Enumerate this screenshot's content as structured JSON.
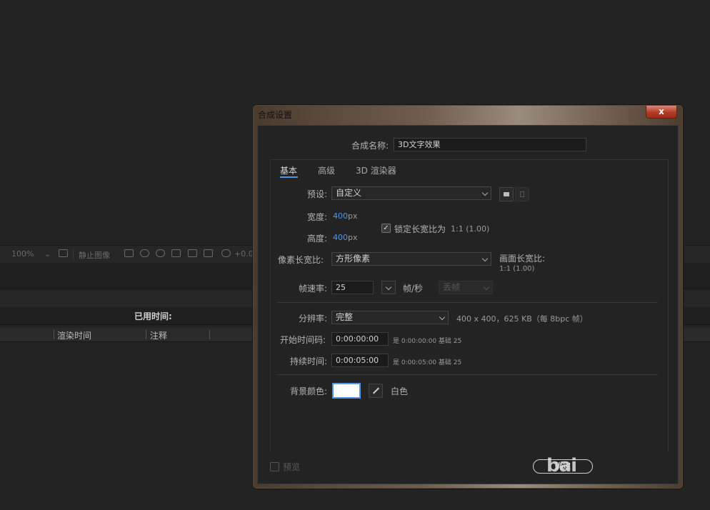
{
  "background": {
    "toolbar": {
      "zoom": "100%",
      "snapshot_label": "静止图像",
      "exposure": "+0.0"
    },
    "elapsed_label": "已用时间:",
    "columns": [
      "渲染时间",
      "注释"
    ]
  },
  "dialog": {
    "title": "合成设置",
    "close_label": "x",
    "comp_name_label": "合成名称:",
    "comp_name_value": "3D文字效果",
    "tabs": [
      {
        "label": "基本",
        "active": true
      },
      {
        "label": "高级",
        "active": false
      },
      {
        "label": "3D 渲染器",
        "active": false
      }
    ],
    "preset_label": "预设:",
    "preset_value": "自定义",
    "width_label": "宽度:",
    "width_value": "400",
    "height_label": "高度:",
    "height_value": "400",
    "unit_px": "px",
    "lock_aspect_label": "锁定长宽比为",
    "lock_aspect_value": "1:1 (1.00)",
    "lock_aspect_checked": true,
    "pixel_aspect_label": "像素长宽比:",
    "pixel_aspect_value": "方形像素",
    "frame_aspect_label": "画面长宽比:",
    "frame_aspect_value": "1:1 (1.00)",
    "frame_rate_label": "帧速率:",
    "frame_rate_value": "25",
    "fps_label": "帧/秒",
    "drop_frame_value": "丢帧",
    "resolution_label": "分辨率:",
    "resolution_value": "完整",
    "resolution_info": "400 x 400，625 KB（每 8bpc 帧）",
    "start_tc_label": "开始时间码:",
    "start_tc_value": "0:00:00:00",
    "start_tc_note": "是 0:00:00:00  基础 25",
    "duration_label": "持续时间:",
    "duration_value": "0:00:05:00",
    "duration_note": "是 0:00:05:00  基础 25",
    "bg_color_label": "背景颜色:",
    "bg_color_name": "白色",
    "bg_color_hex": "#ffffff",
    "preview_label": "预览",
    "ok_label": "确定",
    "accent_color": "#4f98e8"
  },
  "watermark": "bai"
}
